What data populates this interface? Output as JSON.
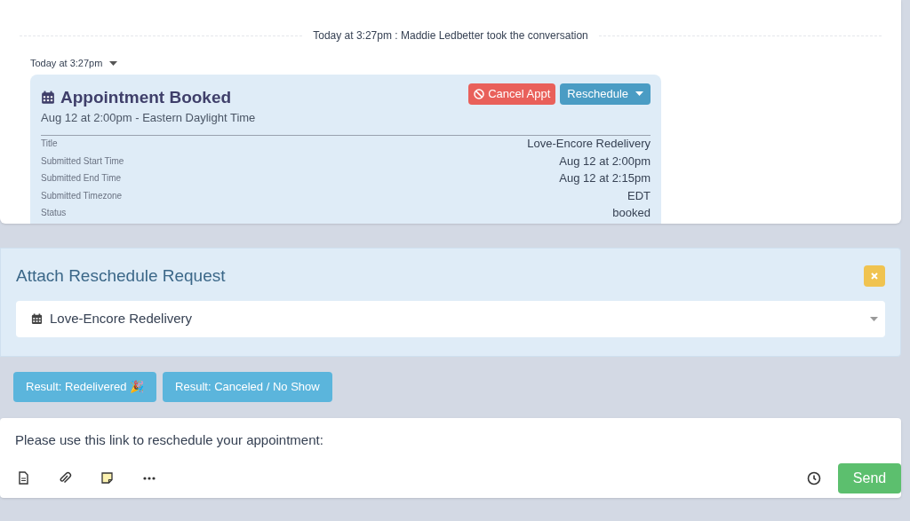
{
  "event": {
    "text": "Today at 3:27pm : Maddie Ledbetter took the conversation"
  },
  "message": {
    "timestamp": "Today at 3:27pm",
    "card": {
      "title": "Appointment Booked",
      "subtitle": "Aug 12 at 2:00pm - Eastern Daylight Time",
      "buttons": [
        {
          "kind": "cancel",
          "label": "Cancel Appt"
        },
        {
          "kind": "dropdown",
          "label": "Reschedule"
        }
      ],
      "fields": [
        {
          "label": "Title",
          "value": "Love-Encore Redelivery"
        },
        {
          "label": "Submitted Start Time",
          "value": "Aug 12 at 2:00pm"
        },
        {
          "label": "Submitted End Time",
          "value": "Aug 12 at 2:15pm"
        },
        {
          "label": "Submitted Timezone",
          "value": "EDT"
        },
        {
          "label": "Status",
          "value": "booked"
        }
      ]
    }
  },
  "attach_panel": {
    "title": "Attach Reschedule Request",
    "select_value": "Love-Encore Redelivery"
  },
  "result_buttons": [
    "Result: Redelivered 🎉",
    "Result: Canceled / No Show"
  ],
  "composer": {
    "value": "Please use this link to reschedule your appointment:",
    "tools": [
      {
        "kind": "document"
      },
      {
        "kind": "paperclip"
      },
      {
        "kind": "note"
      },
      {
        "kind": "more"
      }
    ],
    "send": "Send"
  }
}
